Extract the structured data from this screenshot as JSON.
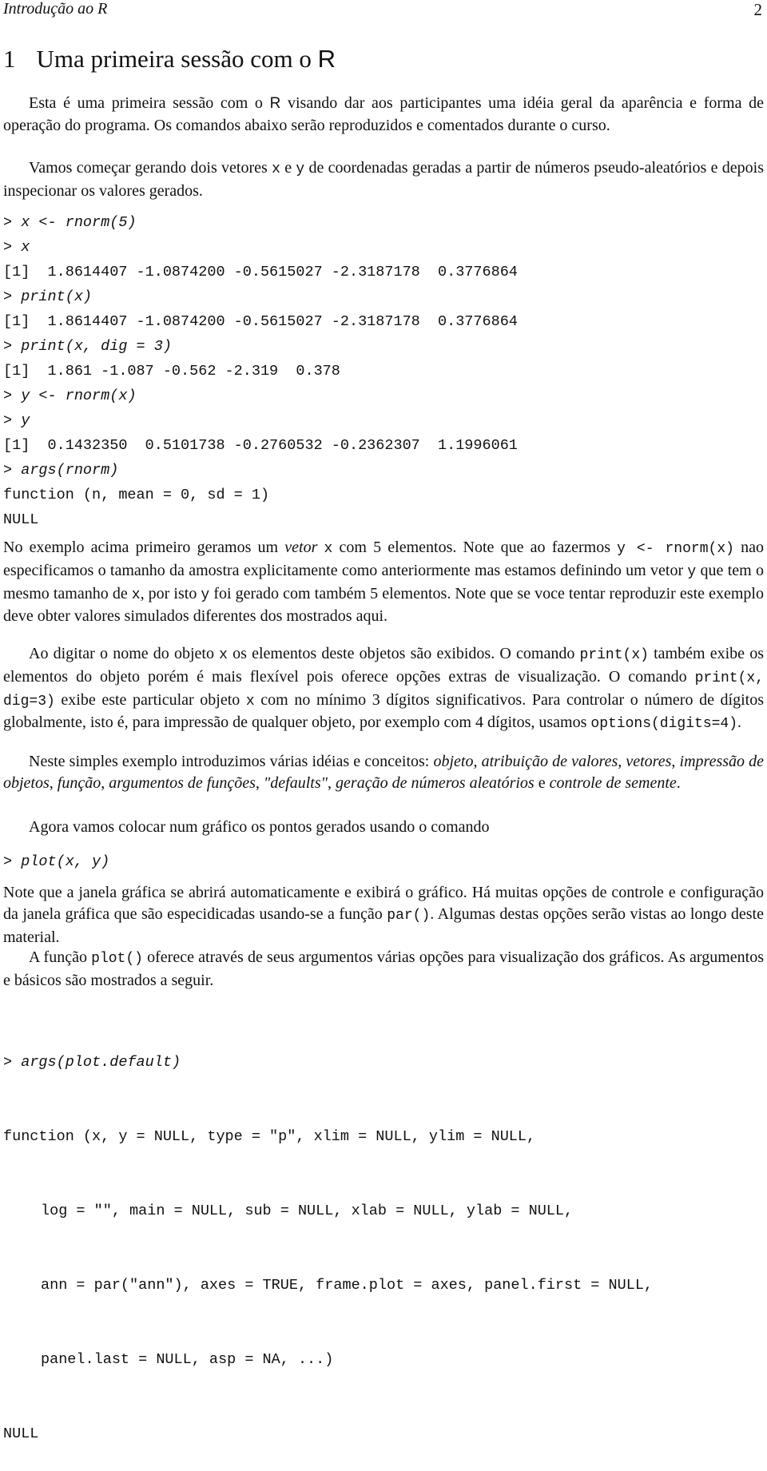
{
  "header": {
    "running_title": "Introdução ao R",
    "page_number": "2"
  },
  "section": {
    "number": "1",
    "title_text": "Uma primeira sessão com o ",
    "title_R": "R"
  },
  "intro": {
    "p1_a": "Esta é uma primeira sessão com o ",
    "p1_R": "R",
    "p1_b": " visando dar aos participantes uma idéia geral da aparência e forma de operação do programa. Os comandos abaixo serão reproduzidos e comentados durante o curso.",
    "p2_a": "Vamos começar gerando dois vetores ",
    "p2_x": "x",
    "p2_b": " e ",
    "p2_y": "y",
    "p2_c": " de coordenadas geradas a partir de números pseudo-aleatórios e depois inspecionar os valores gerados."
  },
  "code1": {
    "prompt": "> ",
    "lines": [
      {
        "type": "cmd",
        "text": "x <- rnorm(5)"
      },
      {
        "type": "cmd",
        "text": "x"
      },
      {
        "type": "out",
        "text": "[1]  1.8614407 -1.0874200 -0.5615027 -2.3187178  0.3776864"
      },
      {
        "type": "cmd",
        "text": "print(x)"
      },
      {
        "type": "out",
        "text": "[1]  1.8614407 -1.0874200 -0.5615027 -2.3187178  0.3776864"
      },
      {
        "type": "cmd",
        "text": "print(x, dig = 3)"
      },
      {
        "type": "out",
        "text": "[1]  1.861 -1.087 -0.562 -2.319  0.378"
      },
      {
        "type": "cmd",
        "text": "y <- rnorm(x)"
      },
      {
        "type": "cmd",
        "text": "y"
      },
      {
        "type": "out",
        "text": "[1]  0.1432350  0.5101738 -0.2760532 -0.2362307  1.1996061"
      },
      {
        "type": "cmd",
        "text": "args(rnorm)"
      },
      {
        "type": "out",
        "text": "function (n, mean = 0, sd = 1) "
      },
      {
        "type": "out",
        "text": "NULL"
      }
    ]
  },
  "para_example": {
    "a": "No exemplo acima primeiro geramos um ",
    "vetor": "vetor",
    "b": " ",
    "x1": "x",
    "c": " com 5 elementos.  Note que ao fazermos ",
    "code_y": "y <- rnorm(x)",
    "d": " nao especificamos o tamanho da amostra explicitamente como anteriormente mas estamos definindo um vetor ",
    "y1": "y",
    "e": " que tem o mesmo tamanho de ",
    "x2": "x",
    "f": ", por isto ",
    "y2": "y",
    "g": " foi gerado com também 5 elementos. Note que se voce tentar reproduzir este exemplo deve obter valores simulados diferentes dos mostrados aqui."
  },
  "para_print": {
    "a": "Ao digitar o nome do objeto ",
    "x1": "x",
    "b": " os elementos deste objetos são exibidos.  O comando ",
    "code_print": "print(x)",
    "c": " também exibe os elementos do objeto porém é mais flexível pois oferece opções extras de visualização. O comando ",
    "code_print_dig": "print(x, dig=3)",
    "d": " exibe este particular objeto ",
    "x2": "x",
    "e": " com no mínimo 3 dígitos significativos. Para controlar o número de dígitos globalmente, isto é, para impressão de qualquer objeto, por exemplo com 4 dígitos, usamos ",
    "code_options": "options(digits=4)",
    "f": "."
  },
  "para_concepts": {
    "a": "Neste simples exemplo introduzimos várias idéias e conceitos: ",
    "i1": "objeto",
    "s1": ", ",
    "i2": "atribuição de valores",
    "s2": ", ",
    "i3": "vetores",
    "s3": ", ",
    "i4": "impressão de objetos",
    "s4": ", ",
    "i5": "função",
    "s5": ", ",
    "i6": "argumentos de funções",
    "s6": ", ",
    "i7": "\"defaults\"",
    "s7": ", ",
    "i8": "geração de números aleatórios",
    "s8": " e ",
    "i9": "controle de semente",
    "end": "."
  },
  "para_plot_intro": "Agora vamos colocar num gráfico os pontos gerados usando o comando",
  "code2": {
    "prompt": "> ",
    "cmd": "plot(x, y)"
  },
  "para_window": {
    "a": "Note que a janela gráfica se abrirá automaticamente e exibirá o gráfico. Há muitas opções de controle e configuração da janela gráfica que são especidicadas usando-se a função ",
    "code_par": "par()",
    "b": ".  Algumas destas opções serão vistas ao longo deste material."
  },
  "para_plotfn": {
    "a": "A função ",
    "code_plot": "plot()",
    "b": " oferece através de seus argumentos várias opções para visualização dos gráficos. As argumentos e básicos são mostrados a seguir."
  },
  "code3": {
    "prompt": "> ",
    "cmd": "args(plot.default)",
    "out_lines": [
      "function (x, y = NULL, type = \"p\", xlim = NULL, ylim = NULL, ",
      "log = \"\", main = NULL, sub = NULL, xlab = NULL, ylab = NULL, ",
      "ann = par(\"ann\"), axes = TRUE, frame.plot = axes, panel.first = NULL, ",
      "panel.last = NULL, asp = NA, ...) ",
      "NULL"
    ]
  }
}
